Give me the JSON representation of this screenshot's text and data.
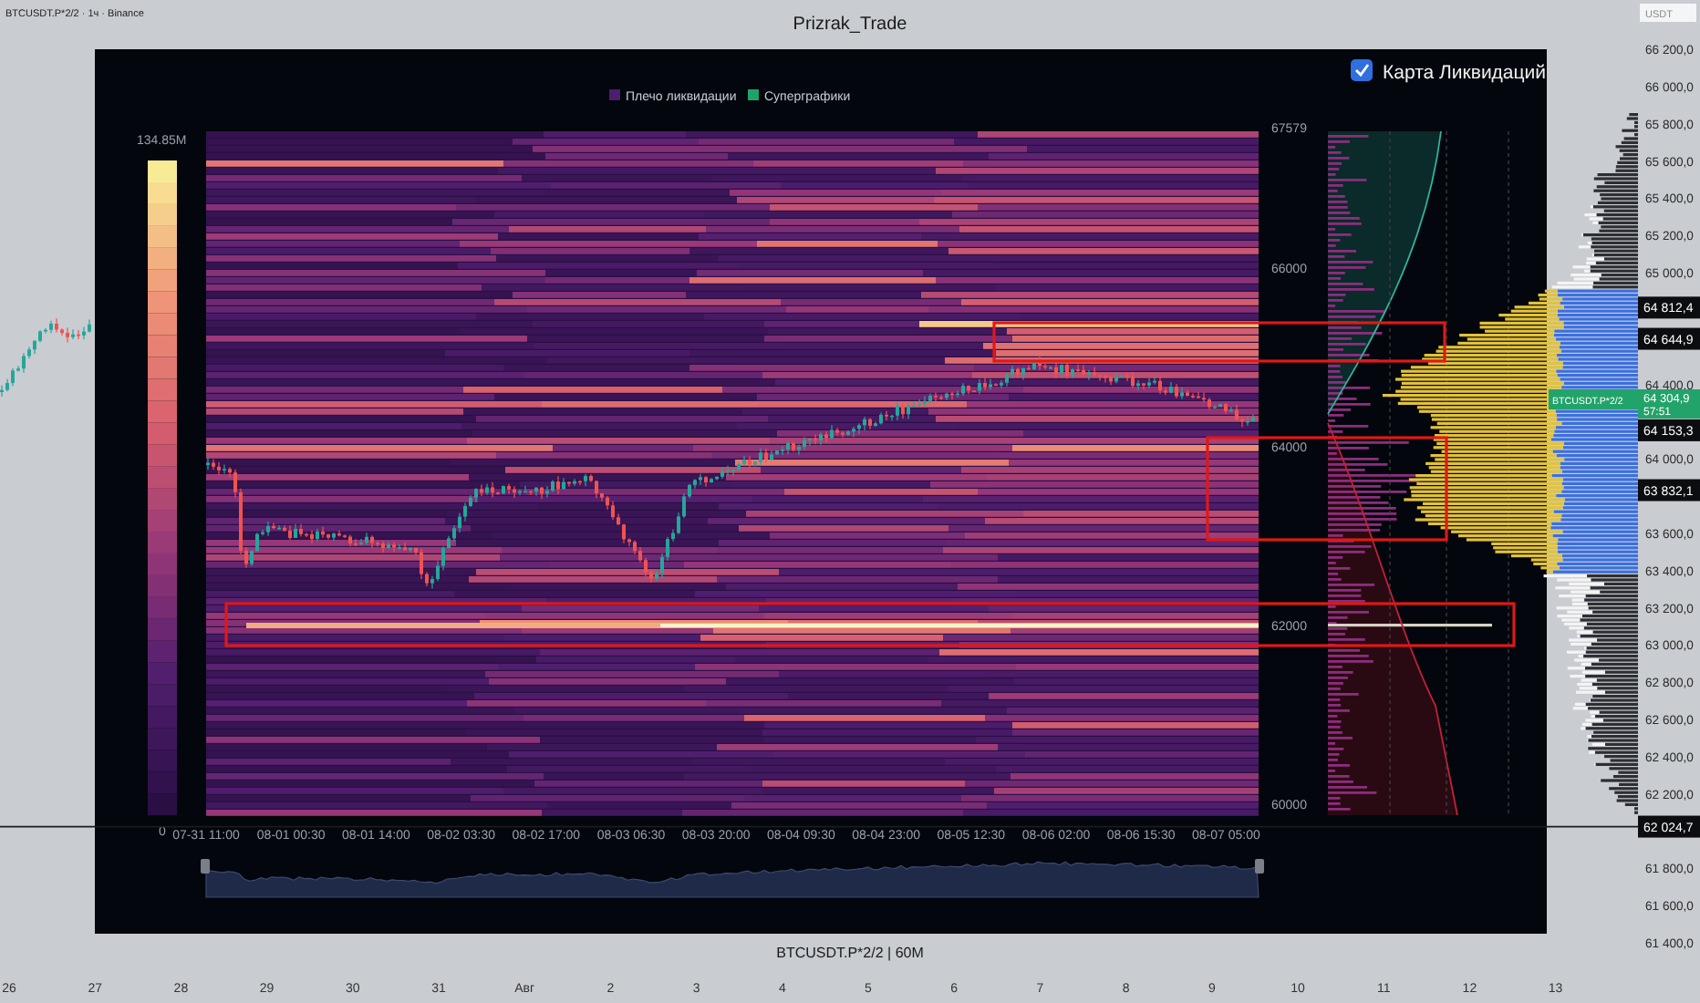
{
  "header": {
    "symbol": "BTCUSDT.P*2/2 · 1ч · Binance",
    "title": "Prizrak_Trade"
  },
  "main_chart": {
    "unit": "USDT",
    "caption": "BTCUSDT.P*2/2 | 60M",
    "price_labels": [
      "66 200,0",
      "66 000,0",
      "65 800,0",
      "65 600,0",
      "65 400,0",
      "65 200,0",
      "65 000,0",
      "64 400,0",
      "64 000,0",
      "63 600,0",
      "63 400,0",
      "63 200,0",
      "63 000,0",
      "62 800,0",
      "62 600,0",
      "62 400,0",
      "62 200,0",
      "61 800,0",
      "61 600,0",
      "61 400,0"
    ],
    "time_labels": [
      "26",
      "27",
      "28",
      "29",
      "30",
      "31",
      "Авг",
      "2",
      "3",
      "4",
      "5",
      "6",
      "7",
      "8",
      "9",
      "10",
      "11",
      "12",
      "13"
    ],
    "price_tags": [
      {
        "text": "64 812,4",
        "kind": "tag"
      },
      {
        "text": "64 644,9",
        "kind": "tag"
      },
      {
        "text": "64 304,9",
        "kind": "last_price",
        "symbol": "BTCUSDT.P*2/2",
        "countdown": "57:51"
      },
      {
        "text": "64 153,3",
        "kind": "tag"
      },
      {
        "text": "63 832,1",
        "kind": "tag"
      },
      {
        "text": "62 024,7",
        "kind": "line_tag"
      }
    ]
  },
  "liquidation_map": {
    "legend": [
      {
        "label": "Плечо ликвидации",
        "color": "#4b1e6e"
      },
      {
        "label": "Суперграфики",
        "color": "#1fa36b"
      }
    ],
    "toggle": {
      "label": "Карта Ликвидаций",
      "checked": true
    },
    "scale": {
      "max": "134.85M",
      "min": "0"
    },
    "price_labels": [
      "67579",
      "66000",
      "64000",
      "62000",
      "60000"
    ],
    "time_labels": [
      "07-31 11:00",
      "08-01 00:30",
      "08-01 14:00",
      "08-02 03:30",
      "08-02 17:00",
      "08-03 06:30",
      "08-03 20:00",
      "08-04 09:30",
      "08-04 23:00",
      "08-05 12:30",
      "08-06 02:00",
      "08-06 15:30",
      "08-07 05:00"
    ]
  }
}
